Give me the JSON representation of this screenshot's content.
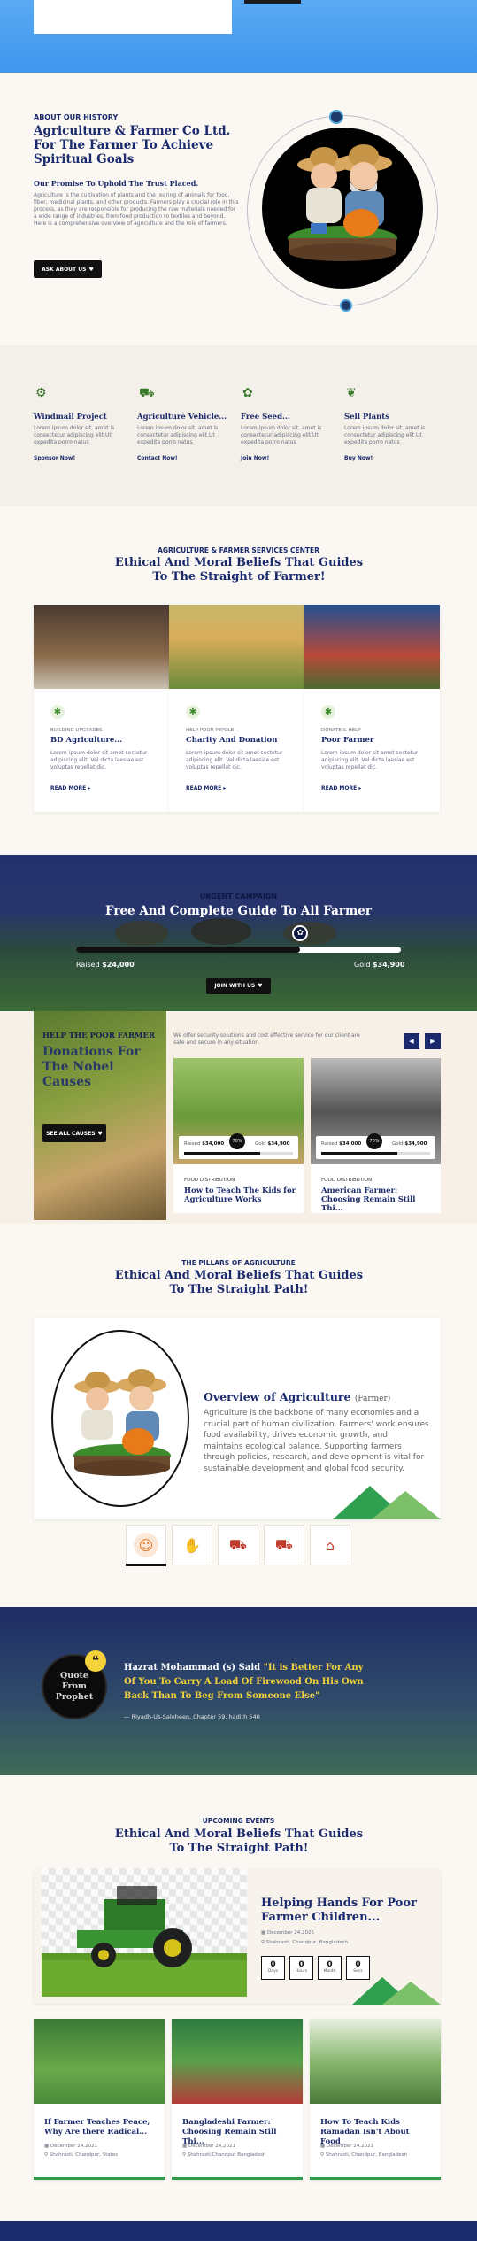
{
  "about": {
    "eyebrow": "ABOUT OUR HISTORY",
    "title": "Agriculture & Farmer Co Ltd. For The Farmer To Achieve Spiritual Goals",
    "subtitle": "Our Promise To Uphold The Trust Placed.",
    "body": "Agriculture is the cultivation of plants and the rearing of animals for food, fiber, medicinal plants, and other products. Farmers play a crucial role in this process, as they are responsible for producing the raw materials needed for a wide range of industries, from food production to textiles and beyond. Here is a comprehensive overview of agriculture and the role of farmers.",
    "button": "ASK ABOUT US"
  },
  "services": [
    {
      "title": "Windmail Project",
      "text": "Lorem ipsum dolor sit, amet is consectetur adipiscing elit.Ut expedita porro natus",
      "link": "Sponsor Now!"
    },
    {
      "title": "Agriculture Vehicle...",
      "text": "Lorem ipsum dolor sit, amet is consectetur adipiscing elit.Ut expedita porro natus",
      "link": "Contact Now!"
    },
    {
      "title": "Free Seed...",
      "text": "Lorem ipsum dolor sit, amet is consectetur adipiscing elit.Ut expedita porro natus",
      "link": "Join Now!"
    },
    {
      "title": "Sell Plants",
      "text": "Lorem ipsum dolor sit, amet is consectetur adipiscing elit.Ut expedita porro natus",
      "link": "Buy Now!"
    }
  ],
  "center": {
    "eyebrow": "AGRICULTURE & FARMER SERVICES CENTER",
    "title": "Ethical And Moral Beliefs That Guides To The Straight of Farmer!",
    "cards": [
      {
        "tag": "BUILDING UPGRADES",
        "title": "BD Agriculture...",
        "text": "Lorem ipsum dolor sit amet sectetur adipiscing elit. Vel dicta laesiae est voluptas repellat dic.",
        "link": "READ MORE"
      },
      {
        "tag": "HELP POOR PEPOLE",
        "title": "Charity And Donation",
        "text": "Lorem ipsum dolor sit amet sectetur adipiscing elit. Vel dicta laesiae est voluptas repellat dic.",
        "link": "READ MORE"
      },
      {
        "tag": "DONATE & HELP",
        "title": "Poor Farmer",
        "text": "Lorem ipsum dolor sit amet sectetur adipiscing elit. Vel dicta laesiae est voluptas repellat dic.",
        "link": "READ MORE"
      }
    ]
  },
  "campaign": {
    "eyebrow": "URGENT CAMPAIGN",
    "title": "Free And Complete Guide To All Farmer",
    "raised_label": "Raised",
    "raised": "$24,000",
    "goal_label": "Gold",
    "goal": "$34,900",
    "progress": 0.69,
    "button": "JOIN WITH US"
  },
  "causes": {
    "eyebrow": "HELP THE POOR FARMER",
    "title": "Donations For The Nobel Causes",
    "button": "SEE ALL CAUSES",
    "intro": "We offer security solutions and cost effective service for our client are safe and secure in any situation.",
    "items": [
      {
        "raised_label": "Raised",
        "raised": "$34,000",
        "goal_label": "Gold",
        "goal": "$34,900",
        "percent": "70%",
        "category": "FOOD DISTRIBUTION",
        "title": "How to Teach The Kids for Agriculture Works"
      },
      {
        "raised_label": "Raised",
        "raised": "$34,000",
        "goal_label": "Gold",
        "goal": "$34,900",
        "percent": "70%",
        "category": "FOOD DISTRIBUTION",
        "title": "American Farmer: Choosing Remain Still Thi..."
      }
    ]
  },
  "pillars": {
    "eyebrow": "THE PILLARS OF AGRICULTURE",
    "title": "Ethical And Moral Beliefs That Guides To The Straight Path!",
    "overview_title": "Overview of Agriculture",
    "overview_sub": "(Farmer)",
    "overview_body": "Agriculture is the backbone of many economies and a crucial part of human civilization. Farmers' work ensures food availability, drives economic growth, and maintains ecological balance. Supporting farmers through policies, research, and development is vital for sustainable development and global food security.",
    "tabs": [
      "farmer-icon",
      "plant-hand-icon",
      "tractor-icon",
      "tractor-red-icon",
      "barn-icon"
    ]
  },
  "quote": {
    "badge": "Quote From Prophet",
    "lead": "Hazrat Mohammad (s) Said",
    "text": "\"It is Better For Any Of You To Carry A Load Of Firewood On His Own Back Than To Beg From Someone Else\"",
    "source": "— Riyadh-Us-Saleheen, Chapter 59, hadith 540"
  },
  "events": {
    "eyebrow": "UPCOMING EVENTS",
    "title": "Ethical And Moral Beliefs That Guides To The Straight Path!",
    "featured": {
      "title": "Helping Hands For Poor Farmer Children...",
      "date": "December 24,2025",
      "location": "Shahrasti, Chandpur, Bangladesh",
      "countdown": [
        {
          "value": "0",
          "label": "Days"
        },
        {
          "value": "0",
          "label": "Hours"
        },
        {
          "value": "0",
          "label": "Month"
        },
        {
          "value": "0",
          "label": "Secs"
        }
      ]
    },
    "items": [
      {
        "title": "If Farmer Teaches Peace, Why Are there Radical...",
        "date": "December 24,2021",
        "location": "Shahrasti, Chandpur, States"
      },
      {
        "title": "Bangladeshi Farmer: Choosing Remain Still Thi...",
        "date": "December 24,2021",
        "location": "Shahrasti,Chandpur Bangladesh"
      },
      {
        "title": "How To Teach Kids Ramadan Isn't About Food",
        "date": "December 24,2021",
        "location": "Shahrasti, Chandpur, Bangladesh"
      }
    ]
  },
  "colors": {
    "navy": "#1a2a6c",
    "green": "#2e9a4a",
    "gold": "#f4d33a",
    "footer": "#1c2b6b",
    "hero": "#4a9ff0"
  }
}
